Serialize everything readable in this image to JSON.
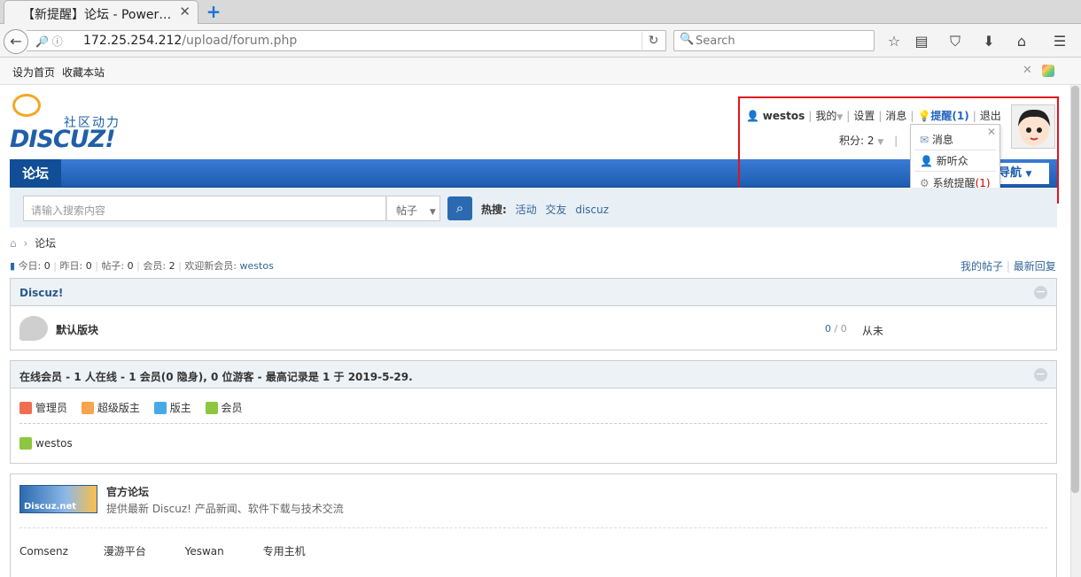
{
  "browser": {
    "tab_title": "【新提醒】论坛 - Power…",
    "url_host": "172.25.254.212",
    "url_path": "/upload/forum.php",
    "search_placeholder": "Search"
  },
  "bookmarks": {
    "set_home": "设为首页",
    "add_fav": "收藏本站"
  },
  "logo": {
    "brand": "DISCUZ!",
    "slogan": "社区动力"
  },
  "user": {
    "name": "westos",
    "my": "我的",
    "settings": "设置",
    "messages": "消息",
    "reminder": "提醒(1)",
    "logout": "退出",
    "credits": "积分: 2"
  },
  "popup": {
    "item1": "消息",
    "item2": "新听众",
    "item3": "系统提醒",
    "item3_count": "(1)"
  },
  "nav": {
    "forum_tab": "论坛",
    "quick_nav": "导航"
  },
  "search": {
    "placeholder": "请输入搜索内容",
    "type": "帖子",
    "hot_label": "热搜:",
    "hot": [
      "活动",
      "交友",
      "discuz"
    ]
  },
  "breadcrumb": {
    "current": "论坛"
  },
  "stats": {
    "today_label": "今日:",
    "today": "0",
    "yesterday_label": "昨日:",
    "yesterday": "0",
    "posts_label": "帖子:",
    "posts": "0",
    "members_label": "会员:",
    "members": "2",
    "welcome_label": "欢迎新会员:",
    "welcome_user": "westos"
  },
  "right_links": {
    "my_posts": "我的帖子",
    "latest_replies": "最新回复"
  },
  "category": {
    "name": "Discuz!",
    "forum_name": "默认版块",
    "threads": "0",
    "posts": "0",
    "last_post": "从未"
  },
  "online": {
    "title": "在线会员 - 1 人在线 - 1 会员(0 隐身), 0 位游客 - 最高记录是 1 于 2019-5-29.",
    "legend": [
      "管理员",
      "超级版主",
      "版主",
      "会员"
    ],
    "users": [
      "westos"
    ]
  },
  "official": {
    "badge": "Discuz.net",
    "title": "官方论坛",
    "desc": "提供最新 Discuz! 产品新闻、软件下载与技术交流",
    "links": [
      "Comsenz",
      "漫游平台",
      "Yeswan",
      "专用主机"
    ]
  },
  "colors": {
    "admin": "#f26c4f",
    "super_mod": "#f7a44c",
    "mod": "#48a9e6",
    "member": "#8dc63f",
    "link": "#336699"
  }
}
